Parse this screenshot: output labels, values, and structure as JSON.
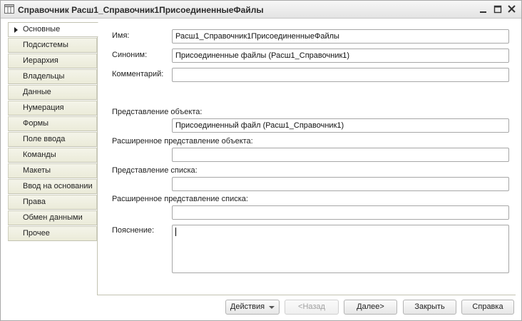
{
  "window": {
    "title": "Справочник Расш1_Справочник1ПрисоединенныеФайлы"
  },
  "nav": {
    "items": [
      {
        "label": "Основные",
        "active": true
      },
      {
        "label": "Подсистемы"
      },
      {
        "label": "Иерархия"
      },
      {
        "label": "Владельцы"
      },
      {
        "label": "Данные"
      },
      {
        "label": "Нумерация"
      },
      {
        "label": "Формы"
      },
      {
        "label": "Поле ввода"
      },
      {
        "label": "Команды"
      },
      {
        "label": "Макеты"
      },
      {
        "label": "Ввод на основании"
      },
      {
        "label": "Права"
      },
      {
        "label": "Обмен данными"
      },
      {
        "label": "Прочее"
      }
    ]
  },
  "form": {
    "name": {
      "label": "Имя:",
      "value": "Расш1_Справочник1ПрисоединенныеФайлы"
    },
    "synonym": {
      "label": "Синоним:",
      "value": "Присоединенные файлы (Расш1_Справочник1)"
    },
    "comment": {
      "label": "Комментарий:",
      "value": ""
    },
    "object_presentation": {
      "label": "Представление объекта:",
      "value": "Присоединенный файл (Расш1_Справочник1)"
    },
    "extended_object_presentation": {
      "label": "Расширенное представление объекта:",
      "value": ""
    },
    "list_presentation": {
      "label": "Представление списка:",
      "value": ""
    },
    "extended_list_presentation": {
      "label": "Расширенное представление списка:",
      "value": ""
    },
    "explanation": {
      "label": "Пояснение:",
      "value": ""
    }
  },
  "buttons": {
    "actions": "Действия",
    "back": "<Назад",
    "next": "Далее>",
    "close": "Закрыть",
    "help": "Справка"
  },
  "icons": {
    "app": "table-grid-icon",
    "minimize": "minimize-icon",
    "maximize": "maximize-icon",
    "close": "close-icon"
  }
}
